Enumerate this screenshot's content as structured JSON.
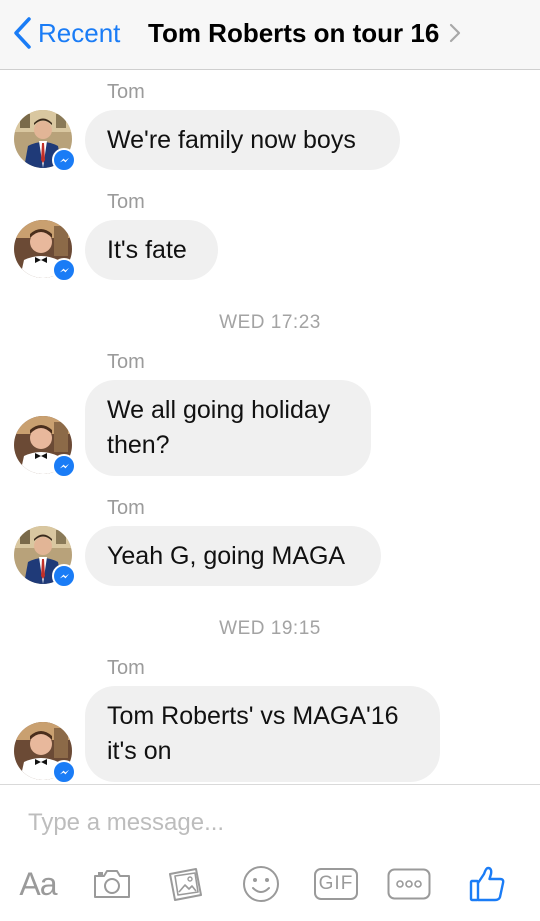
{
  "header": {
    "back_label": "Recent",
    "title": "Tom Roberts on tour 16"
  },
  "thread": {
    "items": [
      {
        "type": "message",
        "sender": "Tom",
        "text": "We're family now boys",
        "avatar": "suit-photo"
      },
      {
        "type": "message",
        "sender": "Tom",
        "text": "It's fate",
        "avatar": "bowtie-photo"
      },
      {
        "type": "timestamp",
        "text": "WED 17:23"
      },
      {
        "type": "message",
        "sender": "Tom",
        "text": "We all going holiday\nthen?",
        "avatar": "bowtie-photo"
      },
      {
        "type": "message",
        "sender": "Tom",
        "text": "Yeah G, going MAGA",
        "avatar": "suit-photo"
      },
      {
        "type": "timestamp",
        "text": "WED 19:15"
      },
      {
        "type": "message",
        "sender": "Tom",
        "text": "Tom Roberts' vs MAGA'16\nit's on",
        "avatar": "bowtie-photo"
      }
    ]
  },
  "composer": {
    "placeholder": "Type a message...",
    "value": "",
    "aa_label": "Aa",
    "gif_label": "GIF"
  },
  "icons": {
    "back": "chevron-left-icon",
    "title_chevron": "chevron-right-icon",
    "badge": "messenger-icon",
    "camera": "camera-icon",
    "gallery": "gallery-icon",
    "emoji": "smiley-icon",
    "more": "more-icon",
    "like": "thumbs-up-icon"
  },
  "colors": {
    "accent": "#1a7cf6",
    "bubble": "#f0f0f0",
    "meta_text": "#9b9b9b",
    "icon_gray": "#9a9a9a"
  }
}
